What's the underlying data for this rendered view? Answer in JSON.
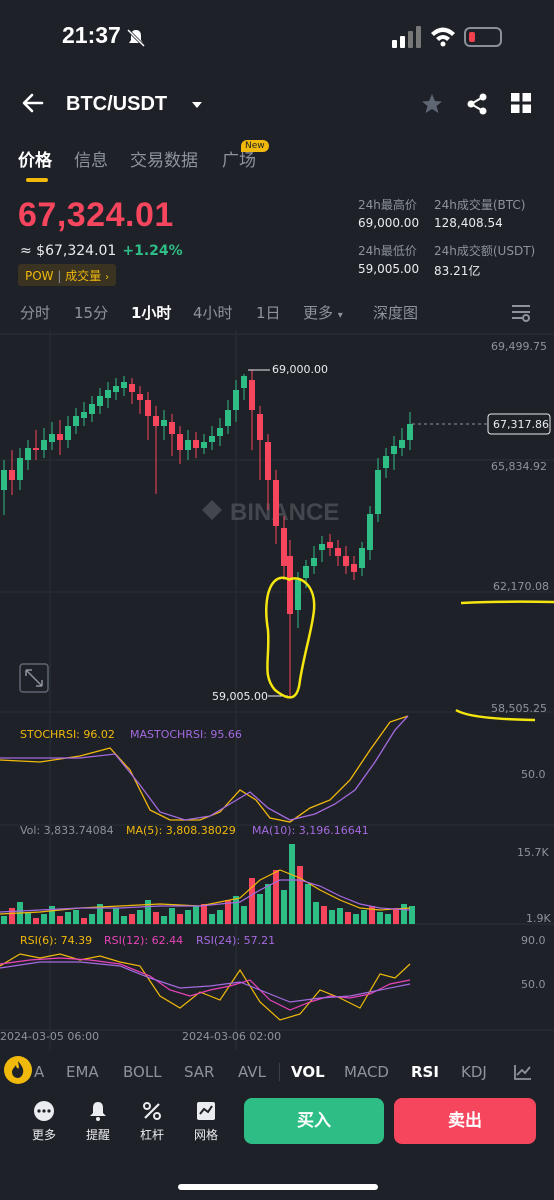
{
  "status": {
    "time": "21:37"
  },
  "header": {
    "pair": "BTC/USDT"
  },
  "tabs": [
    {
      "label": "价格"
    },
    {
      "label": "信息"
    },
    {
      "label": "交易数据"
    },
    {
      "label": "广场"
    }
  ],
  "new_badge": "New",
  "ticker": {
    "last_price": "67,324.01",
    "approx": "≈ $67,324.01",
    "change": "+1.24%",
    "tag": "POW",
    "tag2": "成交量",
    "high_label": "24h最高价",
    "high": "69,000.00",
    "vol_btc_label": "24h成交量(BTC)",
    "vol_btc": "128,408.54",
    "low_label": "24h最低价",
    "low": "59,005.00",
    "vol_usdt_label": "24h成交额(USDT)",
    "vol_usdt": "83.21亿"
  },
  "intervals": [
    "分时",
    "15分",
    "1小时",
    "4小时",
    "1日",
    "更多",
    "深度图"
  ],
  "chart": {
    "axis": [
      "69,499.75",
      "65,834.92",
      "62,170.08",
      "58,505.25"
    ],
    "current_tag": "67,317.86",
    "high_marker": "69,000.00",
    "low_marker": "59,005.00",
    "watermark": "BINANCE",
    "stoch": {
      "k": "STOCHRSI: 96.02",
      "d": "MASTOCHRSI: 95.66",
      "axis": "50.0"
    },
    "vol": {
      "v": "Vol: 3,833.74084",
      "ma5": "MA(5): 3,808.38029",
      "ma10": "MA(10): 3,196.16641",
      "axis_top": "15.7K",
      "axis_bot": "1.9K"
    },
    "rsi": {
      "r6": "RSI(6): 74.39",
      "r12": "RSI(12): 62.44",
      "r24": "RSI(24): 57.21",
      "axis_top": "90.0",
      "axis_mid": "50.0"
    },
    "dates": [
      "2024-03-05 06:00",
      "2024-03-06 02:00"
    ]
  },
  "indicator_tabs": [
    "A",
    "EMA",
    "BOLL",
    "SAR",
    "AVL",
    "VOL",
    "MACD",
    "RSI",
    "KDJ"
  ],
  "bottom": {
    "more": "更多",
    "alert": "提醒",
    "leverage": "杠杆",
    "grid": "网格",
    "buy": "买入",
    "sell": "卖出"
  },
  "colors": {
    "up": "#2ebd85",
    "down": "#f6465d",
    "accent": "#f0b90b"
  },
  "icons": [
    "bell-off-icon",
    "signal-icon",
    "wifi-icon",
    "battery-icon",
    "back-arrow-icon",
    "caret-down-icon",
    "star-icon",
    "share-icon",
    "grid-icon",
    "settings-icon",
    "expand-icon",
    "fire-icon",
    "more-dots-icon",
    "bell-icon",
    "leverage-icon",
    "grid-bot-icon"
  ]
}
